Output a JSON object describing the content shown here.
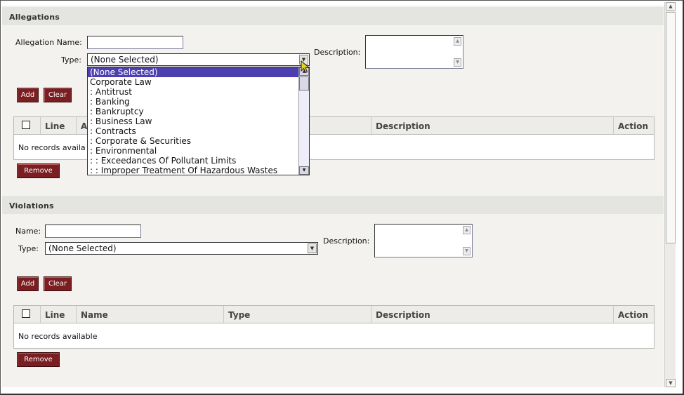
{
  "allegations": {
    "section_title": "Allegations",
    "name_label": "Allegation Name:",
    "name_value": "",
    "type_label": "Type:",
    "type_selected": "(None Selected)",
    "description_label": "Description:",
    "add_label": "Add",
    "clear_label": "Clear",
    "remove_label": "Remove",
    "grid": {
      "col_line": "Line",
      "col_name_partial": "A",
      "col_description": "Description",
      "col_action": "Action",
      "empty_text": "No records availa"
    },
    "type_dropdown": {
      "options": [
        "(None Selected)",
        "Corporate Law",
        ": Antitrust",
        ": Banking",
        ": Bankruptcy",
        ": Business Law",
        ": Contracts",
        ": Corporate & Securities",
        ": Environmental",
        ": : Exceedances Of Pollutant Limits",
        ": : Improper Treatment Of Hazardous Wastes"
      ],
      "selected_index": 0
    }
  },
  "violations": {
    "section_title": "Violations",
    "name_label": "Name:",
    "name_value": "",
    "type_label": "Type:",
    "type_selected": "(None Selected)",
    "description_label": "Description:",
    "add_label": "Add",
    "clear_label": "Clear",
    "remove_label": "Remove",
    "grid": {
      "col_line": "Line",
      "col_name": "Name",
      "col_type": "Type",
      "col_description": "Description",
      "col_action": "Action",
      "empty_text": "No records available"
    }
  },
  "colors": {
    "button_bg": "#7a1e22",
    "selected_option_bg": "#4c3fb0",
    "section_header_bg": "#e4e4e0",
    "panel_bg": "#f3f2ee"
  },
  "icons": [
    "chevron-down-icon",
    "scroll-up-icon",
    "scroll-down-icon",
    "mouse-pointer-icon",
    "checkbox-icon"
  ]
}
